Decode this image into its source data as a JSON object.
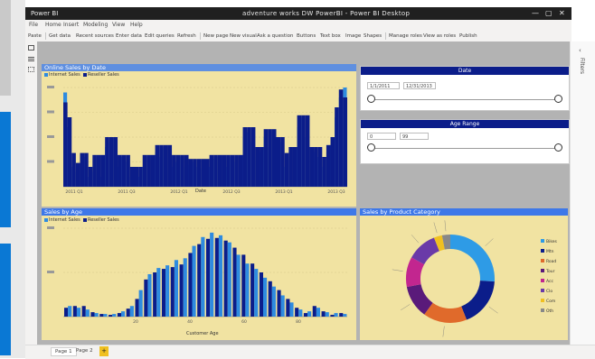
{
  "window": {
    "title": "adventure works DW PowerBI - Power BI Desktop",
    "app_icon_label": "Power BI",
    "controls": [
      "—",
      "▢",
      "✕"
    ]
  },
  "menu": [
    "File",
    "Home",
    "Insert",
    "Modeling",
    "View",
    "Help"
  ],
  "toolbar": [
    "Paste",
    "Get data",
    "Recent sources",
    "Enter data",
    "Edit queries",
    "Refresh",
    "New page",
    "New visual",
    "Ask a question",
    "Buttons",
    "Text box",
    "Image",
    "Shapes",
    "Manage roles",
    "View as roles",
    "Publish"
  ],
  "panels": {
    "top_left": {
      "title": "Online Sales by Date",
      "legend": [
        "Internet Sales",
        "Reseller Sales"
      ],
      "xaxis_label": "Date"
    },
    "bottom_left": {
      "title": "Sales by Age",
      "legend": [
        "Internet Sales",
        "Reseller Sales"
      ],
      "xaxis_label": "Customer Age"
    },
    "bottom_right": {
      "title": "Sales by Product Category"
    }
  },
  "slicers": [
    {
      "title": "Date",
      "from": "1/1/2011",
      "to": "12/31/2013"
    },
    {
      "title": "Age Range",
      "from": "0",
      "to": "99"
    }
  ],
  "right_pane": {
    "label": "Filters"
  },
  "tabs": {
    "pages": [
      "Page 1",
      "Page 2"
    ],
    "add": "+"
  },
  "colors": {
    "dark_bar": "#0b1d8a",
    "light_bar": "#2e8be0",
    "panel_bg": "#f1e3a2",
    "accent": "#0a78d4"
  },
  "chart_data": [
    {
      "type": "bar",
      "title": "Online Sales by Date",
      "series": [
        {
          "name": "Internet Sales",
          "values": [
            0.85,
            0.7,
            0.34,
            0.24,
            0.34,
            0.34,
            0.2,
            0.32,
            0.32,
            0.32,
            0.5,
            0.5,
            0.5,
            0.32,
            0.32,
            0.32,
            0.2,
            0.2,
            0.2,
            0.32,
            0.32,
            0.32,
            0.42,
            0.42,
            0.42,
            0.42,
            0.32,
            0.32,
            0.32,
            0.32,
            0.28,
            0.28,
            0.28,
            0.28,
            0.28,
            0.32,
            0.32,
            0.32,
            0.32,
            0.32,
            0.32,
            0.32,
            0.32,
            0.6,
            0.6,
            0.6,
            0.4,
            0.4,
            0.58,
            0.58,
            0.58,
            0.5,
            0.5,
            0.34,
            0.4,
            0.4,
            0.72,
            0.72,
            0.72,
            0.4,
            0.4,
            0.4,
            0.3,
            0.42,
            0.5,
            0.8,
            0.98,
            0.9
          ]
        },
        {
          "name": "Reseller Sales",
          "values": [
            0.95,
            0.6,
            0.2,
            0.15,
            0.22,
            0.3,
            0.1,
            0.15,
            0.25,
            0.1,
            0.4,
            0.45,
            0.5,
            0.2,
            0.3,
            0.25,
            0.1,
            0.15,
            0.1,
            0.2,
            0.3,
            0.25,
            0.35,
            0.3,
            0.4,
            0.3,
            0.2,
            0.25,
            0.3,
            0.2,
            0.22,
            0.25,
            0.2,
            0.18,
            0.25,
            0.2,
            0.28,
            0.3,
            0.25,
            0.2,
            0.3,
            0.25,
            0.2,
            0.5,
            0.55,
            0.45,
            0.3,
            0.35,
            0.5,
            0.4,
            0.55,
            0.3,
            0.45,
            0.2,
            0.3,
            0.35,
            0.6,
            0.7,
            0.5,
            0.3,
            0.35,
            0.3,
            0.2,
            0.35,
            0.45,
            0.7,
            0.9,
            1.0
          ]
        }
      ],
      "xticks": [
        "2011 Q1",
        "2011 Q3",
        "2012 Q1",
        "2012 Q3",
        "2013 Q1",
        "2013 Q3"
      ]
    },
    {
      "type": "bar",
      "title": "Sales by Age",
      "series": [
        {
          "name": "Internet Sales",
          "values": [
            0.1,
            0.12,
            0.12,
            0.05,
            0.03,
            0.02,
            0.04,
            0.09,
            0.2,
            0.42,
            0.5,
            0.54,
            0.56,
            0.59,
            0.72,
            0.82,
            0.88,
            0.89,
            0.86,
            0.78,
            0.7,
            0.6,
            0.5,
            0.4,
            0.3,
            0.2,
            0.1,
            0.04,
            0.12,
            0.06,
            0.02,
            0.04
          ]
        },
        {
          "name": "Reseller Sales",
          "values": [
            0.12,
            0.1,
            0.08,
            0.04,
            0.03,
            0.03,
            0.06,
            0.12,
            0.3,
            0.48,
            0.55,
            0.58,
            0.64,
            0.66,
            0.8,
            0.9,
            0.95,
            0.92,
            0.84,
            0.7,
            0.6,
            0.54,
            0.44,
            0.34,
            0.24,
            0.16,
            0.08,
            0.06,
            0.1,
            0.05,
            0.04,
            0.03
          ]
        }
      ],
      "xticks": [
        "20",
        "40",
        "60",
        "80"
      ]
    },
    {
      "type": "pie",
      "title": "Sales by Product Category",
      "values": [
        26,
        18,
        16,
        12,
        11,
        11,
        3,
        3
      ],
      "colors": [
        "#2e9be6",
        "#0b1d8a",
        "#e06a2b",
        "#5a1a7a",
        "#c2268f",
        "#6a3aa8",
        "#f0c020",
        "#888888"
      ],
      "legend": [
        "Bikes",
        "Mtn",
        "Road",
        "Tour",
        "Acc",
        "Clo",
        "Com",
        "Oth"
      ]
    }
  ]
}
